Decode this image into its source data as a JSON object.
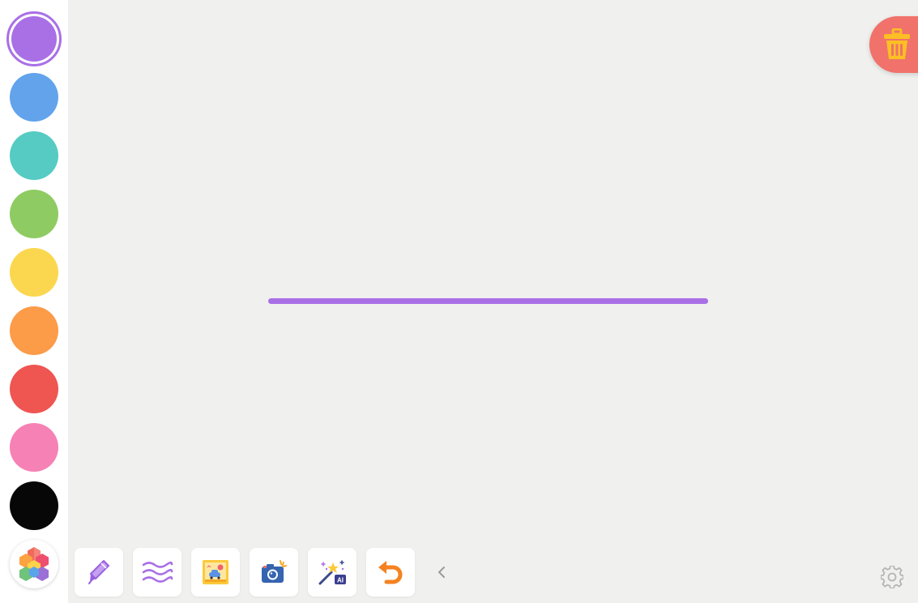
{
  "palette": {
    "selected_index": 0,
    "colors": [
      {
        "name": "purple",
        "hex": "#a970e6"
      },
      {
        "name": "blue",
        "hex": "#62a3ec"
      },
      {
        "name": "teal",
        "hex": "#55cbc3"
      },
      {
        "name": "green",
        "hex": "#8fcb63"
      },
      {
        "name": "yellow",
        "hex": "#fbd74f"
      },
      {
        "name": "orange",
        "hex": "#fc9b48"
      },
      {
        "name": "red",
        "hex": "#ef5551"
      },
      {
        "name": "pink",
        "hex": "#f681b5"
      },
      {
        "name": "black",
        "hex": "#070707"
      }
    ],
    "more_colors_icon": "color-hexagon-icon"
  },
  "canvas": {
    "background": "#f0f0ee",
    "stroke_color": "#a970e6"
  },
  "toolbar": {
    "tools": [
      {
        "name": "pen-tool",
        "icon": "pen-icon"
      },
      {
        "name": "wave-tool",
        "icon": "wave-lines-icon"
      },
      {
        "name": "sticker-tool",
        "icon": "picture-frame-icon"
      },
      {
        "name": "camera-tool",
        "icon": "camera-icon"
      },
      {
        "name": "ai-tool",
        "icon": "magic-wand-ai-icon",
        "badge": "AI"
      },
      {
        "name": "undo-tool",
        "icon": "undo-icon"
      }
    ],
    "collapse_icon": "chevron-left-icon",
    "settings_icon": "gear-icon"
  },
  "trash": {
    "icon": "trash-icon",
    "color": "#f0726b"
  }
}
